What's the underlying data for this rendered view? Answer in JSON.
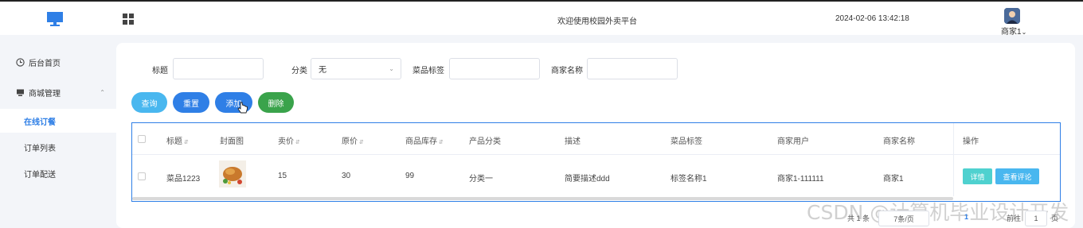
{
  "header": {
    "logo_icon": "monitor-icon",
    "menu_icon": "grid-icon",
    "welcome": "欢迎使用校园外卖平台",
    "datetime": "2024-02-06 13:42:18",
    "user_name": "商家1",
    "user_caret": "⌄",
    "accent_color": "#2f7fe6"
  },
  "sidebar": {
    "home": {
      "label": "后台首页",
      "icon": "clock-icon"
    },
    "mall": {
      "label": "商城管理",
      "icon": "monitor-icon",
      "chevron": "⌃"
    },
    "items": [
      {
        "label": "在线订餐",
        "active": true
      },
      {
        "label": "订单列表",
        "active": false
      },
      {
        "label": "订单配送",
        "active": false
      }
    ]
  },
  "search": {
    "title_label": "标题",
    "title_value": "",
    "category_label": "分类",
    "category_value": "无",
    "tag_label": "菜品标签",
    "tag_value": "",
    "merchant_label": "商家名称",
    "merchant_value": ""
  },
  "actions": {
    "query": "查询",
    "reset": "重置",
    "add": "添加",
    "delete": "删除"
  },
  "table": {
    "columns": [
      "标题",
      "封面图",
      "卖价",
      "原价",
      "商品库存",
      "产品分类",
      "描述",
      "菜品标签",
      "商家用户",
      "商家名称",
      "操作"
    ],
    "rows": [
      {
        "title": "菜品1223",
        "sell_price": "15",
        "original_price": "30",
        "stock": "99",
        "category": "分类一",
        "description": "简要描述ddd",
        "tag": "标签名称1",
        "merchant_user": "商家1-111111",
        "merchant_name": "商家1",
        "detail_btn": "详情",
        "review_btn": "查看评论"
      }
    ]
  },
  "pagination": {
    "total": "共 1 条",
    "page_size": "7条/页",
    "current_page": "1",
    "goto_label": "前往",
    "goto_value": "1",
    "page_unit": "页"
  },
  "watermark": "CSDN @计算机毕业设计开发"
}
